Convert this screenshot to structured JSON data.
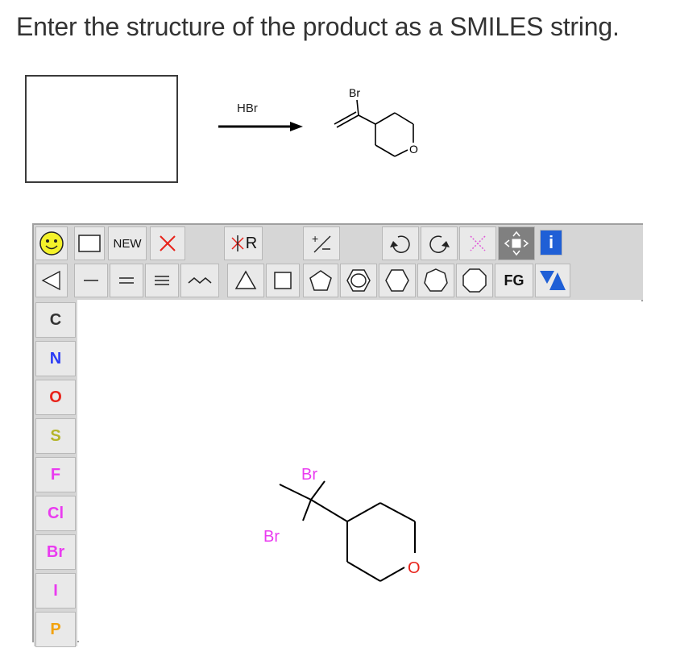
{
  "question": {
    "prompt": "Enter the structure of the product as a SMILES string."
  },
  "reaction": {
    "reagent": "HBr",
    "reactant_br_label": "Br",
    "reactant_o_label": "O"
  },
  "toolbar": {
    "new_label": "NEW",
    "r_label": "R",
    "fg_label": "FG",
    "info_label": "i"
  },
  "elements": [
    {
      "symbol": "C",
      "color": "#333333"
    },
    {
      "symbol": "N",
      "color": "#2a3cf5"
    },
    {
      "symbol": "O",
      "color": "#e8231b"
    },
    {
      "symbol": "S",
      "color": "#b5b52a"
    },
    {
      "symbol": "F",
      "color": "#ea3bf0"
    },
    {
      "symbol": "Cl",
      "color": "#ea3bf0"
    },
    {
      "symbol": "Br",
      "color": "#ea3bf0"
    },
    {
      "symbol": "I",
      "color": "#ea3bf0"
    },
    {
      "symbol": "P",
      "color": "#f2a20e"
    }
  ],
  "canvas": {
    "br_top": "Br",
    "br_bottom": "Br",
    "o_label": "O"
  },
  "colors": {
    "halogen": "#ea3bf0",
    "oxygen": "#e8231b"
  }
}
